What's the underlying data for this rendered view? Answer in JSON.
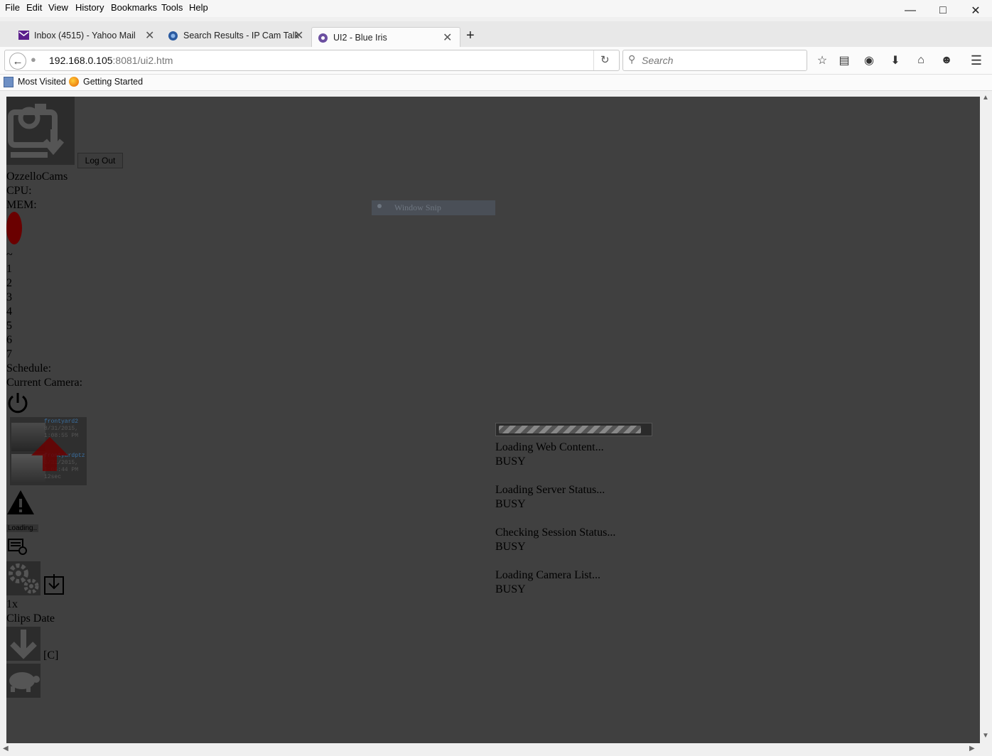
{
  "menu": [
    "File",
    "Edit",
    "View",
    "History",
    "Bookmarks",
    "Tools",
    "Help"
  ],
  "tabs": [
    {
      "label": "Inbox (4515) - Yahoo Mail",
      "color": "#5b1e8c"
    },
    {
      "label": "Search Results - IP Cam Talk",
      "color": "#2a5aa0"
    },
    {
      "label": "UI2 - Blue Iris",
      "color": "#6b4fa0"
    }
  ],
  "url": {
    "host": "192.168.0.105",
    "rest": ":8081/ui2.htm"
  },
  "search_placeholder": "Search",
  "bookmarks": [
    "Most Visited",
    "Getting Started"
  ],
  "page": {
    "logout": "Log Out",
    "system_name": "OzzelloCams",
    "cpu": "CPU:",
    "mem": "MEM:",
    "tilde": "~",
    "profiles": [
      "1",
      "2",
      "3",
      "4",
      "5",
      "6",
      "7"
    ],
    "schedule": "Schedule:",
    "current_camera": "Current Camera:",
    "cam1": {
      "name": "frontyard2",
      "date": "8/31/2015,",
      "time": "1:08:55 PM"
    },
    "cam2": {
      "name": "frontyardptz",
      "date": "8/31/2015,",
      "time": "1:04:44 PM",
      "dur": "12sec"
    },
    "loading_small": "Loading..",
    "speed": "1x",
    "clips_date": "Clips Date",
    "c_label": "[C]",
    "snip": "Window Snip"
  },
  "loading": {
    "progress": 0.95,
    "steps": [
      {
        "label": "Loading Web Content...",
        "state": "BUSY"
      },
      {
        "label": "Loading Server Status...",
        "state": "BUSY"
      },
      {
        "label": "Checking Session Status...",
        "state": "BUSY"
      },
      {
        "label": "Loading Camera List...",
        "state": "BUSY"
      }
    ]
  }
}
